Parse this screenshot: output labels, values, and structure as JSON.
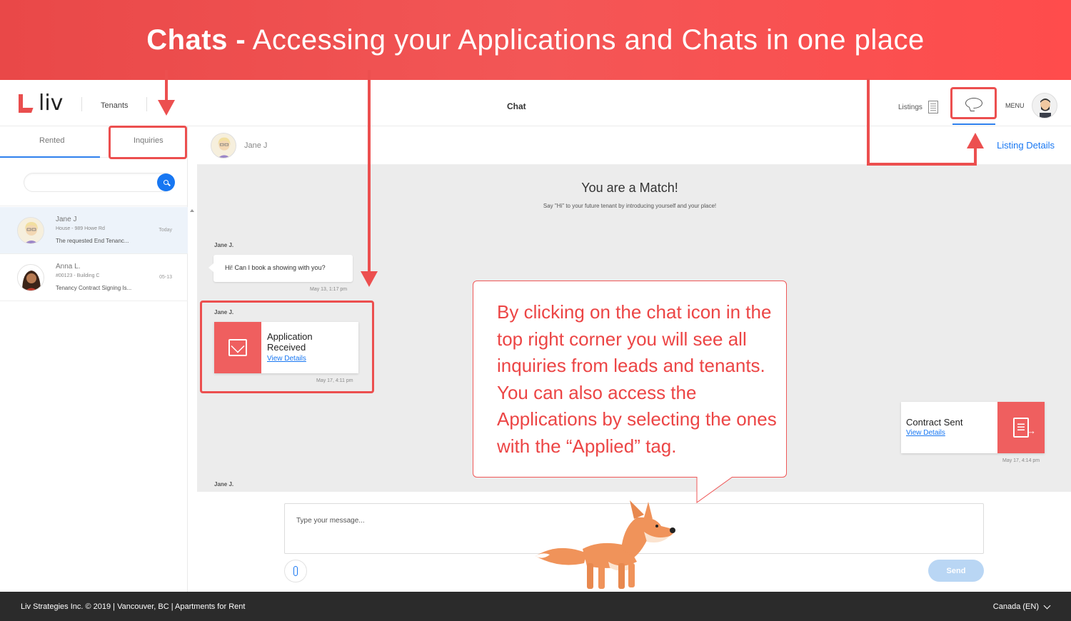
{
  "banner": {
    "title_bold": "Chats -",
    "title_rest": " Accessing your Applications and Chats in one place"
  },
  "header": {
    "logo_text": "liv",
    "tenants_label": "Tenants",
    "chat_title": "Chat",
    "listings_label": "Listings",
    "menu_label": "MENU"
  },
  "sidebar": {
    "tabs": [
      {
        "label": "Rented"
      },
      {
        "label": "Inquiries"
      }
    ],
    "search_placeholder": "",
    "conversations": [
      {
        "name": "Jane J",
        "subtitle": "House - 989 Howe Rd",
        "preview": "The requested End Tenanc...",
        "time": "Today"
      },
      {
        "name": "Anna L.",
        "subtitle": "#00123 - Building C",
        "preview": "Tenancy Contract Signing Is...",
        "time": "05-13"
      }
    ]
  },
  "chat": {
    "contact_name": "Jane J",
    "listing_details_link": "Listing Details",
    "match_title": "You are a Match!",
    "match_subtitle": "Say \"Hi\" to your future tenant by introducing yourself and your place!",
    "messages": [
      {
        "sender": "Jane J.",
        "text": "Hi! Can I book a showing with you?",
        "timestamp": "May 13, 1:17 pm"
      },
      {
        "sender": "Jane J.",
        "card_title": "Application Received",
        "card_link": "View Details",
        "timestamp": "May 17, 4:11 pm"
      },
      {
        "card_title": "Contract Sent",
        "card_link": "View Details",
        "timestamp": "May 17, 4:14 pm"
      },
      {
        "sender": "Jane J."
      }
    ],
    "composer_placeholder": "Type your message...",
    "send_label": "Send"
  },
  "callout": {
    "text": "By clicking on the chat icon in the top right corner you will see all inquiries from leads and tenants. You can also access the Applications by selecting the ones with the “Applied” tag."
  },
  "footer": {
    "left_text": "Liv Strategies Inc. © 2019 | Vancouver, BC | Apartments for Rent",
    "locale": "Canada (EN)"
  },
  "colors": {
    "accent_red": "#ec4f4f",
    "link_blue": "#1877f2",
    "chat_bg": "#ececec",
    "footer_bg": "#2b2b2b"
  },
  "icons": [
    "chat-bubble-icon",
    "building-icon",
    "search-icon",
    "envelope-document-icon",
    "contract-document-icon",
    "paperclip-icon",
    "chevron-down-icon"
  ]
}
